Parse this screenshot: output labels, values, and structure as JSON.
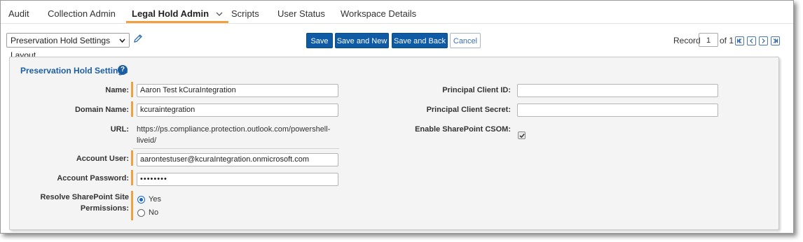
{
  "nav": {
    "tabs": [
      {
        "label": "Audit"
      },
      {
        "label": "Collection Admin"
      },
      {
        "label": "Legal Hold Admin"
      },
      {
        "label": "Scripts"
      },
      {
        "label": "User Status"
      },
      {
        "label": "Workspace Details"
      }
    ],
    "active_tab": "Legal Hold Admin"
  },
  "toolbar": {
    "layout_select_value": "Preservation Hold Settings Layout",
    "save_label": "Save",
    "save_and_new_label": "Save and New",
    "save_and_back_label": "Save and Back",
    "cancel_label": "Cancel",
    "record_label": "Record",
    "record_value": "1",
    "record_of": "of 1"
  },
  "section": {
    "title": "Preservation Hold Settings",
    "help_glyph": "?"
  },
  "form": {
    "name_label": "Name:",
    "name_value": "Aaron Test kCuraIntegration",
    "domain_label": "Domain Name:",
    "domain_value": "kcuraintegration",
    "url_label": "URL:",
    "url_line1": "https://ps.compliance.protection.outlook.com/powershell-",
    "url_line2": "liveid/",
    "account_user_label": "Account User:",
    "account_user_value": "aarontestuser@kcuraIntegration.onmicrosoft.com",
    "account_password_label": "Account Password:",
    "account_password_value": "••••••••",
    "resolve_label_line1": "Resolve SharePoint Site",
    "resolve_label_line2": "Permissions:",
    "resolve_yes": "Yes",
    "resolve_no": "No",
    "resolve_selected": "Yes",
    "principal_client_id_label": "Principal Client ID:",
    "principal_client_id_value": "",
    "principal_client_secret_label": "Principal Client Secret:",
    "principal_client_secret_value": "",
    "enable_csom_label": "Enable SharePoint CSOM:",
    "enable_csom_checked": true
  },
  "colors": {
    "accent_orange": "#f2a03d",
    "primary_button": "#0e5aa5",
    "section_title": "#1b5ea3"
  }
}
